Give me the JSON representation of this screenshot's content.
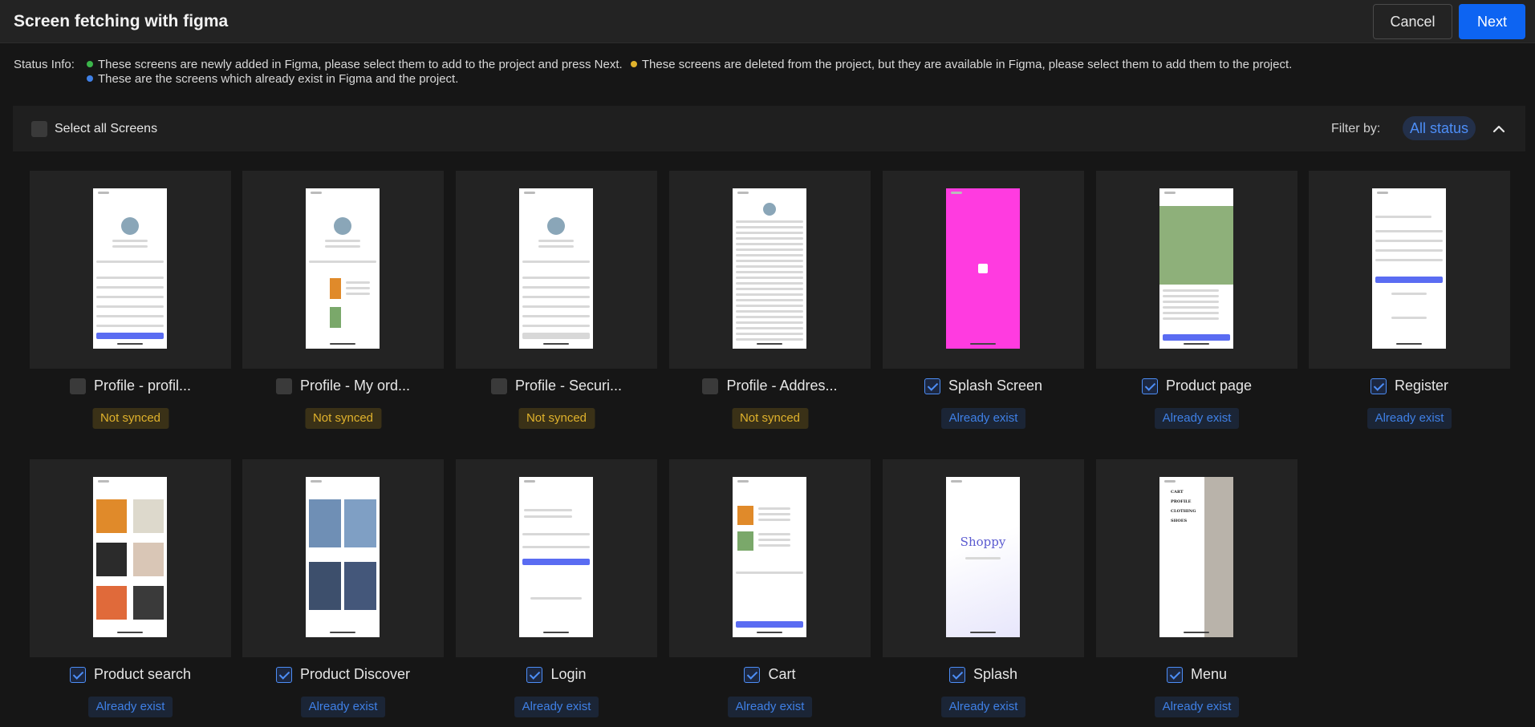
{
  "header": {
    "title": "Screen fetching with figma",
    "cancel_label": "Cancel",
    "next_label": "Next"
  },
  "status_info": {
    "label": "Status Info:",
    "green": "These screens are newly added in Figma, please select them to add to the project and press Next.",
    "yellow": "These screens are deleted from the project, but they are available in Figma, please select them to add them to the project.",
    "blue": "These are the screens which already exist in Figma and the project."
  },
  "colors": {
    "green": "#3bb54a",
    "yellow": "#e0b22c",
    "blue": "#3f80e6",
    "accent": "#0d64f2"
  },
  "toolbar": {
    "select_all_label": "Select all Screens",
    "filter_label": "Filter by:",
    "filter_value": "All status"
  },
  "screens": [
    {
      "name": "Profile - profil...",
      "status": "Not synced",
      "checked": false,
      "preview": "profile"
    },
    {
      "name": "Profile - My ord...",
      "status": "Not synced",
      "checked": false,
      "preview": "orders"
    },
    {
      "name": "Profile - Securi...",
      "status": "Not synced",
      "checked": false,
      "preview": "security"
    },
    {
      "name": "Profile - Addres...",
      "status": "Not synced",
      "checked": false,
      "preview": "address"
    },
    {
      "name": "Splash Screen",
      "status": "Already exist",
      "checked": true,
      "preview": "splash-pink"
    },
    {
      "name": "Product page",
      "status": "Already exist",
      "checked": true,
      "preview": "product"
    },
    {
      "name": "Register",
      "status": "Already exist",
      "checked": true,
      "preview": "register"
    },
    {
      "name": "Product search",
      "status": "Already exist",
      "checked": true,
      "preview": "search"
    },
    {
      "name": "Product Discover",
      "status": "Already exist",
      "checked": true,
      "preview": "discover"
    },
    {
      "name": "Login",
      "status": "Already exist",
      "checked": true,
      "preview": "login"
    },
    {
      "name": "Cart",
      "status": "Already exist",
      "checked": true,
      "preview": "cart"
    },
    {
      "name": "Splash",
      "status": "Already exist",
      "checked": true,
      "preview": "splash",
      "preview_text": "Shoppy"
    },
    {
      "name": "Menu",
      "status": "Already exist",
      "checked": true,
      "preview": "menu",
      "preview_items": [
        "CART",
        "PROFILE",
        "CLOTHING",
        "SHOES"
      ]
    }
  ]
}
